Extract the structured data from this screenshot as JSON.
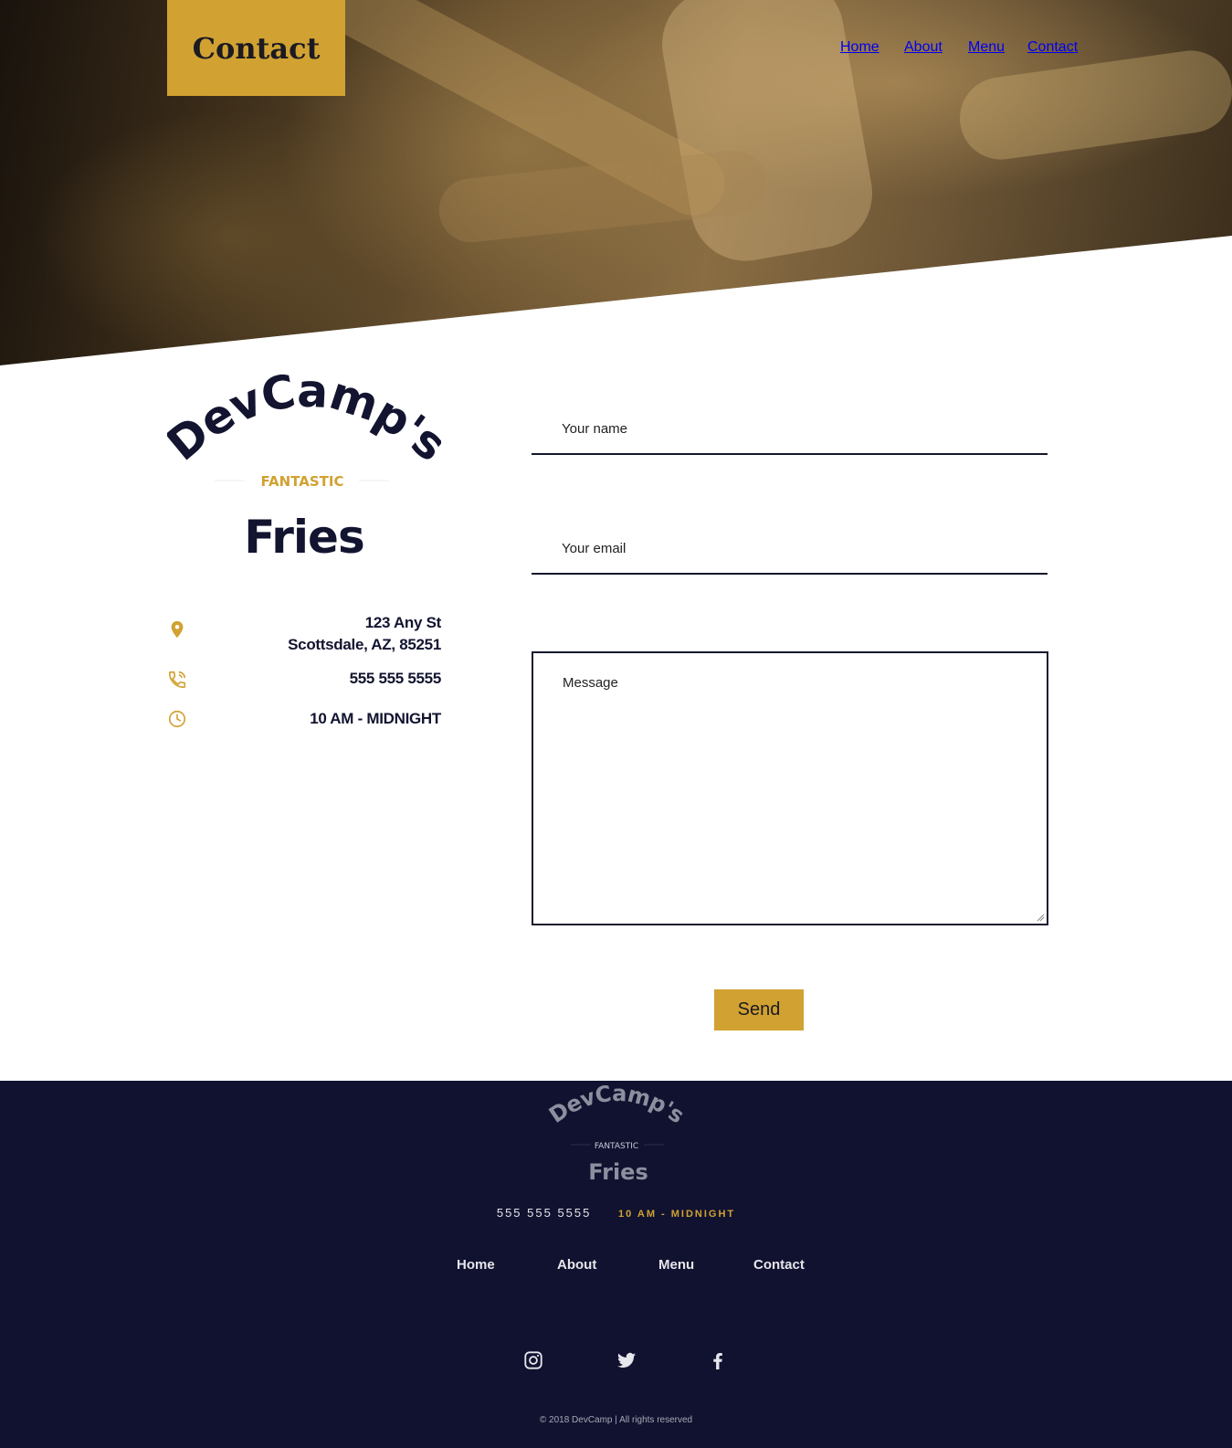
{
  "header": {
    "page_title": "Contact",
    "nav": [
      "Home",
      "About",
      "Menu",
      "Contact"
    ]
  },
  "brand": {
    "line1": "DevCamp's",
    "line2": "FANTASTIC",
    "line3": "Fries",
    "colors": {
      "gold": "#d1a232",
      "navy": "#121430"
    }
  },
  "contact_info": {
    "address_line1": "123 Any St",
    "address_line2": "Scottsdale, AZ, 85251",
    "phone": "555 555 5555",
    "hours": "10 AM - MIDNIGHT",
    "icons": [
      "map-pin-icon",
      "phone-icon",
      "clock-icon"
    ]
  },
  "form": {
    "name_placeholder": "Your name",
    "email_placeholder": "Your email",
    "message_placeholder": "Message",
    "send_label": "Send"
  },
  "footer": {
    "phone": "555 555 5555",
    "hours": "10 AM - MIDNIGHT",
    "nav": [
      "Home",
      "About",
      "Menu",
      "Contact"
    ],
    "social_icons": [
      "instagram-icon",
      "twitter-icon",
      "facebook-icon"
    ],
    "copyright": "© 2018 DevCamp | All rights reserved"
  }
}
